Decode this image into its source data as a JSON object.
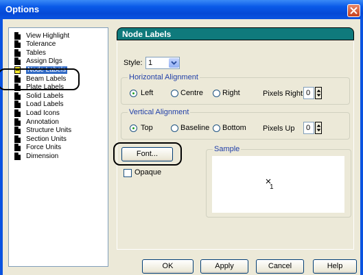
{
  "window": {
    "title": "Options"
  },
  "tree": {
    "items": [
      {
        "label": "View Highlight"
      },
      {
        "label": "Tolerance"
      },
      {
        "label": "Tables"
      },
      {
        "label": "Assign Dlgs"
      },
      {
        "label": "Node Labels",
        "selected": true
      },
      {
        "label": "Beam Labels"
      },
      {
        "label": "Plate Labels"
      },
      {
        "label": "Solid Labels"
      },
      {
        "label": "Load Labels"
      },
      {
        "label": "Load Icons"
      },
      {
        "label": "Annotation"
      },
      {
        "label": "Structure Units"
      },
      {
        "label": "Section Units"
      },
      {
        "label": "Force Units"
      },
      {
        "label": "Dimension"
      }
    ]
  },
  "panel": {
    "title": "Node Labels",
    "style_label": "Style:",
    "style_value": "1",
    "horizontal": {
      "legend": "Horizontal Alignment",
      "left": "Left",
      "centre": "Centre",
      "right": "Right",
      "pixels_label": "Pixels Right",
      "pixels_value": "0",
      "selected": "Left"
    },
    "vertical": {
      "legend": "Vertical Alignment",
      "top": "Top",
      "baseline": "Baseline",
      "bottom": "Bottom",
      "pixels_label": "Pixels Up",
      "pixels_value": "0",
      "selected": "Top"
    },
    "font_button": "Font...",
    "opaque_label": "Opaque",
    "sample": {
      "legend": "Sample",
      "text": "1"
    }
  },
  "buttons": {
    "ok": "OK",
    "apply": "Apply",
    "cancel": "Cancel",
    "help": "Help"
  },
  "colors": {
    "titlebar": "#0a53e0",
    "panel_header": "#0f7a7c",
    "selection": "#316ac5"
  }
}
